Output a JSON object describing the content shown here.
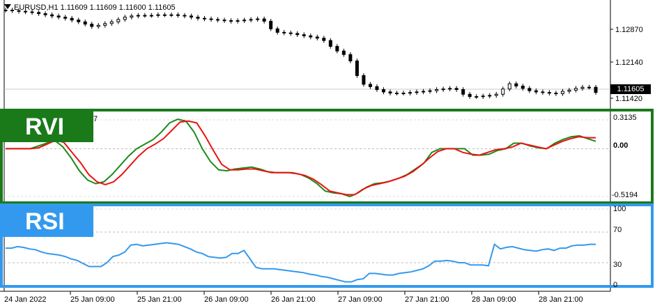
{
  "chart": {
    "symbol_header": "EURUSD,H1  1.11609 1.11609 1.11600 1.11605",
    "price_axis": [
      "1.12870",
      "1.12140",
      "1.11420"
    ],
    "current_price": "1.11605",
    "rvi_badge": "RVI",
    "rvi_label_partial": "7",
    "rvi_axis": [
      "0.3135",
      "0.00",
      "-0.5194"
    ],
    "rsi_badge": "RSI",
    "rsi_axis": [
      "100",
      "70",
      "30",
      "0"
    ],
    "time_axis": [
      "24 Jan 2022",
      "25 Jan 09:00",
      "25 Jan 21:00",
      "26 Jan 09:00",
      "26 Jan 21:00",
      "27 Jan 09:00",
      "27 Jan 21:00",
      "28 Jan 09:00",
      "28 Jan 21:00"
    ],
    "colors": {
      "rvi_frame": "#1a7a1a",
      "rvi_main": "#1a8a1a",
      "rvi_signal": "#ee1111",
      "rsi_frame": "#3399ee",
      "rsi_line": "#3399ee"
    }
  },
  "chart_data": [
    {
      "type": "line",
      "title": "EURUSD,H1",
      "ylim": [
        1.1138,
        1.1305
      ],
      "series": [
        {
          "values": [
            1.1302,
            1.1301,
            1.13,
            1.1299,
            1.1298,
            1.1296,
            1.1294,
            1.1292,
            1.129,
            1.1288,
            1.1285,
            1.1282,
            1.1278,
            1.1274,
            1.1276,
            1.1279,
            1.1282,
            1.1286,
            1.129,
            1.1292,
            1.1293,
            1.1293,
            1.1293,
            1.1294,
            1.1294,
            1.1294,
            1.1293,
            1.1292,
            1.129,
            1.1288,
            1.1287,
            1.1286,
            1.1285,
            1.1284,
            1.1283,
            1.1284,
            1.1285,
            1.1286,
            1.1287,
            1.1283,
            1.127,
            1.1264,
            1.1263,
            1.1262,
            1.126,
            1.1258,
            1.1256,
            1.1254,
            1.125,
            1.124,
            1.1232,
            1.1226,
            1.1215,
            1.119,
            1.1175,
            1.1171,
            1.1166,
            1.1162,
            1.116,
            1.116,
            1.116,
            1.1161,
            1.1162,
            1.1163,
            1.1164,
            1.1166,
            1.1167,
            1.1168,
            1.1166,
            1.1158,
            1.1154,
            1.1154,
            1.1155,
            1.1156,
            1.1158,
            1.1167,
            1.1176,
            1.1172,
            1.1168,
            1.1164,
            1.1162,
            1.1161,
            1.116,
            1.1159,
            1.1163,
            1.1165,
            1.1168,
            1.117,
            1.117,
            1.1161
          ]
        }
      ]
    },
    {
      "type": "line",
      "title": "RVI",
      "ylim": [
        -0.5194,
        0.3135
      ],
      "series": [
        {
          "values": [
            0.0,
            0.0,
            0.0,
            0.0,
            0.03,
            0.06,
            0.09,
            0.02,
            -0.1,
            -0.24,
            -0.34,
            -0.38,
            -0.36,
            -0.28,
            -0.18,
            -0.08,
            0.0,
            0.05,
            0.1,
            0.18,
            0.28,
            0.32,
            0.3,
            0.18,
            0.0,
            -0.14,
            -0.23,
            -0.24,
            -0.22,
            -0.21,
            -0.2,
            -0.22,
            -0.25,
            -0.26,
            -0.26,
            -0.26,
            -0.28,
            -0.32,
            -0.38,
            -0.46,
            -0.48,
            -0.49,
            -0.52,
            -0.48,
            -0.42,
            -0.38,
            -0.37,
            -0.35,
            -0.32,
            -0.28,
            -0.22,
            -0.16,
            -0.04,
            0.0,
            0.0,
            0.0,
            0.0,
            -0.07,
            -0.07,
            -0.06,
            -0.02,
            0.0,
            0.06,
            0.06,
            0.03,
            0.01,
            0.0,
            0.06,
            0.1,
            0.13,
            0.14,
            0.11,
            0.08
          ]
        },
        {
          "values": [
            0.0,
            0.0,
            0.0,
            0.0,
            0.01,
            0.05,
            0.09,
            0.07,
            -0.04,
            -0.15,
            -0.28,
            -0.36,
            -0.39,
            -0.36,
            -0.28,
            -0.18,
            -0.08,
            0.0,
            0.05,
            0.11,
            0.2,
            0.29,
            0.3,
            0.28,
            0.14,
            -0.02,
            -0.17,
            -0.23,
            -0.23,
            -0.22,
            -0.22,
            -0.24,
            -0.26,
            -0.26,
            -0.26,
            -0.27,
            -0.29,
            -0.33,
            -0.39,
            -0.46,
            -0.48,
            -0.5,
            -0.5,
            -0.44,
            -0.4,
            -0.38,
            -0.36,
            -0.33,
            -0.3,
            -0.25,
            -0.18,
            -0.1,
            -0.03,
            0.0,
            0.0,
            -0.04,
            -0.06,
            -0.07,
            -0.04,
            -0.01,
            0.0,
            0.02,
            0.06,
            0.04,
            0.02,
            0.0,
            0.04,
            0.08,
            0.11,
            0.13,
            0.12,
            0.12
          ]
        }
      ]
    },
    {
      "type": "line",
      "title": "RSI",
      "ylim": [
        0,
        100
      ],
      "series": [
        {
          "values": [
            49,
            49,
            51,
            50,
            48,
            47,
            44,
            42,
            41,
            40,
            38,
            35,
            33,
            29,
            25,
            25,
            25,
            30,
            38,
            40,
            44,
            53,
            54,
            52,
            53,
            54,
            55,
            56,
            55,
            54,
            51,
            48,
            44,
            42,
            38,
            37,
            36,
            37,
            42,
            42,
            46,
            35,
            24,
            22,
            22,
            22,
            21,
            20,
            19,
            18,
            17,
            15,
            14,
            12,
            11,
            9,
            7,
            5,
            5,
            8,
            9,
            16,
            16,
            15,
            14,
            14,
            16,
            17,
            18,
            20,
            22,
            26,
            32,
            32,
            33,
            32,
            30,
            30,
            27,
            27,
            27,
            26,
            54,
            48,
            50,
            51,
            49,
            47,
            46,
            45,
            47,
            48,
            46,
            49,
            49,
            52,
            53,
            53,
            54,
            54
          ]
        }
      ]
    }
  ]
}
